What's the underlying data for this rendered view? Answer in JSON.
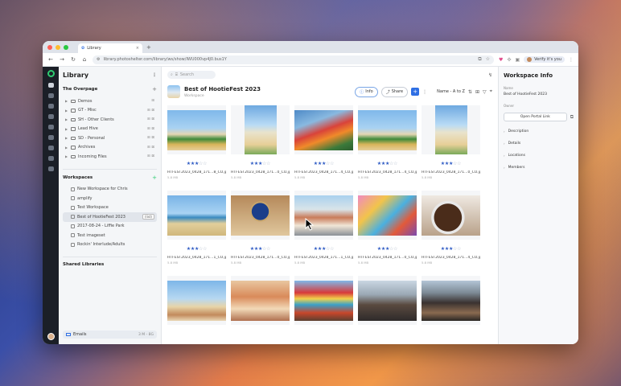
{
  "browser": {
    "tab_title": "Library",
    "tab_close": "×",
    "new_tab": "+",
    "url": "library.photoshelter.com/library/ws/show/IWU000vp4J0.bus1Y",
    "profile_label": "Verify it's you",
    "traffic_colors": [
      "#ff5f57",
      "#febc2e",
      "#28c840"
    ],
    "nav": {
      "back": "←",
      "forward": "→",
      "reload": "↻",
      "home": "⌂"
    }
  },
  "sidebar": {
    "title": "Library",
    "more": "⋮",
    "section_overpage": {
      "title": "The Overpage",
      "plus": "+"
    },
    "folders": [
      {
        "label": "Demos",
        "right": "⊞"
      },
      {
        "label": "GT - Misc",
        "right": "⊞ ⊠"
      },
      {
        "label": "SH - Other Clients",
        "right": "⊞ ⊠"
      },
      {
        "label": "Lead Hive",
        "right": "⊞ ⊠"
      },
      {
        "label": "SD - Personal",
        "right": "⊞ ⊠"
      },
      {
        "label": "Archives",
        "right": "⊞ ⊠"
      },
      {
        "label": "Incoming Files",
        "right": "⊞ ⊠"
      }
    ],
    "section_workspaces": {
      "title": "Workspaces",
      "plus": "+"
    },
    "workspaces": [
      {
        "label": "New Workspace for Chris",
        "selected": false
      },
      {
        "label": "amplify",
        "selected": false
      },
      {
        "label": "Test Workspace",
        "selected": false
      },
      {
        "label": "Best of HootieFest 2023",
        "selected": true,
        "badge": "(list)"
      },
      {
        "label": "2017-08-24 - Liffie Park",
        "selected": false
      },
      {
        "label": "Test imageset",
        "selected": false
      },
      {
        "label": "Rockin' Interlude/Adults",
        "selected": false
      }
    ],
    "section_shared": {
      "title": "Shared Libraries"
    },
    "email": {
      "label": "Emails",
      "right": "3 M - 8G"
    }
  },
  "main": {
    "search_placeholder": "Search",
    "workspace_title": "Best of HootieFest 2023",
    "workspace_sub": "Workspace",
    "info_label": "Info",
    "share_label": "Share",
    "add_label": "+",
    "sort_label": "Name - A to Z",
    "photos": [
      {
        "name": "HTFEST2023_0428_171...8_CO.jpg",
        "size": "5.8 MB",
        "rating": 3,
        "scene": "beach-umbrella",
        "tall": false
      },
      {
        "name": "HTFEST2023_0428_171...0_CO.jpg",
        "size": "5.8 MB",
        "rating": 3,
        "scene": "beach-sign",
        "tall": true
      },
      {
        "name": "HTFEST2023_0428_171...4_CO.jpg",
        "size": "5.8 MB",
        "rating": 3,
        "scene": "flowers-red",
        "tall": false
      },
      {
        "name": "HTFEST2023_0428_171...4_CO.jpg",
        "size": "5.8 MB",
        "rating": 3,
        "scene": "beach-umbrella",
        "tall": false
      },
      {
        "name": "HTFEST2023_0428_171...0_CO.jpg",
        "size": "5.8 MB",
        "rating": 3,
        "scene": "beach-sign",
        "tall": true
      },
      {
        "name": "HTFEST2023_0428_171...1_CO.jpg",
        "size": "5.8 MB",
        "rating": 3,
        "scene": "beach-person",
        "tall": false
      },
      {
        "name": "HTFEST2023_0428_171...0_CO.jpg",
        "size": "5.8 MB",
        "rating": 3,
        "scene": "medal",
        "tall": false
      },
      {
        "name": "HTFEST2023_0428_171...1_CO.jpg",
        "size": "5.8 MB",
        "rating": 3,
        "scene": "street-people",
        "tall": false
      },
      {
        "name": "HTFEST2023_0428_171...0_CO.jpg",
        "size": "5.8 MB",
        "rating": 3,
        "scene": "mural-people",
        "tall": false
      },
      {
        "name": "HTFEST2023_0428_171...4_CO.jpg",
        "size": "5.8 MB",
        "rating": 3,
        "scene": "coffee",
        "tall": false
      },
      {
        "name": "",
        "size": "",
        "rating": 0,
        "scene": "group-beach",
        "tall": false
      },
      {
        "name": "",
        "size": "",
        "rating": 0,
        "scene": "warm-interior",
        "tall": false
      },
      {
        "name": "",
        "size": "",
        "rating": 0,
        "scene": "tent-red",
        "tall": false
      },
      {
        "name": "",
        "size": "",
        "rating": 0,
        "scene": "crowd",
        "tall": false
      },
      {
        "name": "",
        "size": "",
        "rating": 0,
        "scene": "building",
        "tall": false
      }
    ]
  },
  "info_panel": {
    "title": "Workspace Info",
    "name_label": "Name",
    "name_value": "Best of HootieFest 2023",
    "owner_label": "Owner",
    "portal_button": "Open Portal Link",
    "sections": [
      "Description",
      "Details",
      "Locations",
      "Members"
    ]
  },
  "colors": {
    "accent": "#2f6fe4",
    "rail": "#1b1f27",
    "star_on": "#2f5bc4"
  }
}
